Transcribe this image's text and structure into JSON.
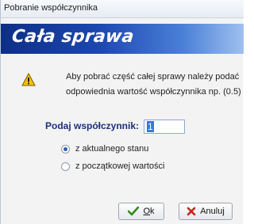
{
  "window": {
    "title": "Pobranie współczynnika"
  },
  "banner": {
    "title": "Cała sprawa"
  },
  "message": {
    "line1": "Aby  pobrać część całej sprawy należy podać",
    "line2": "odpowiednia wartość współczynnika np. (0.5)"
  },
  "form": {
    "label": "Podaj współczynnik:",
    "value": "1"
  },
  "options": [
    {
      "label": "z aktualnego stanu",
      "checked": true
    },
    {
      "label": "z początkowej wartości",
      "checked": false
    }
  ],
  "buttons": {
    "ok": {
      "label_first": "O",
      "label_rest": "k",
      "icon": "checkmark-icon"
    },
    "cancel": {
      "label": "Anuluj",
      "icon": "cross-icon"
    }
  },
  "colors": {
    "banner_start": "#0d2f86",
    "banner_end": "#9fc0ef",
    "label_blue": "#1d2f7d",
    "ok_green": "#2f8a1f",
    "cancel_red": "#c0271c",
    "warning_yellow": "#f4c400"
  }
}
